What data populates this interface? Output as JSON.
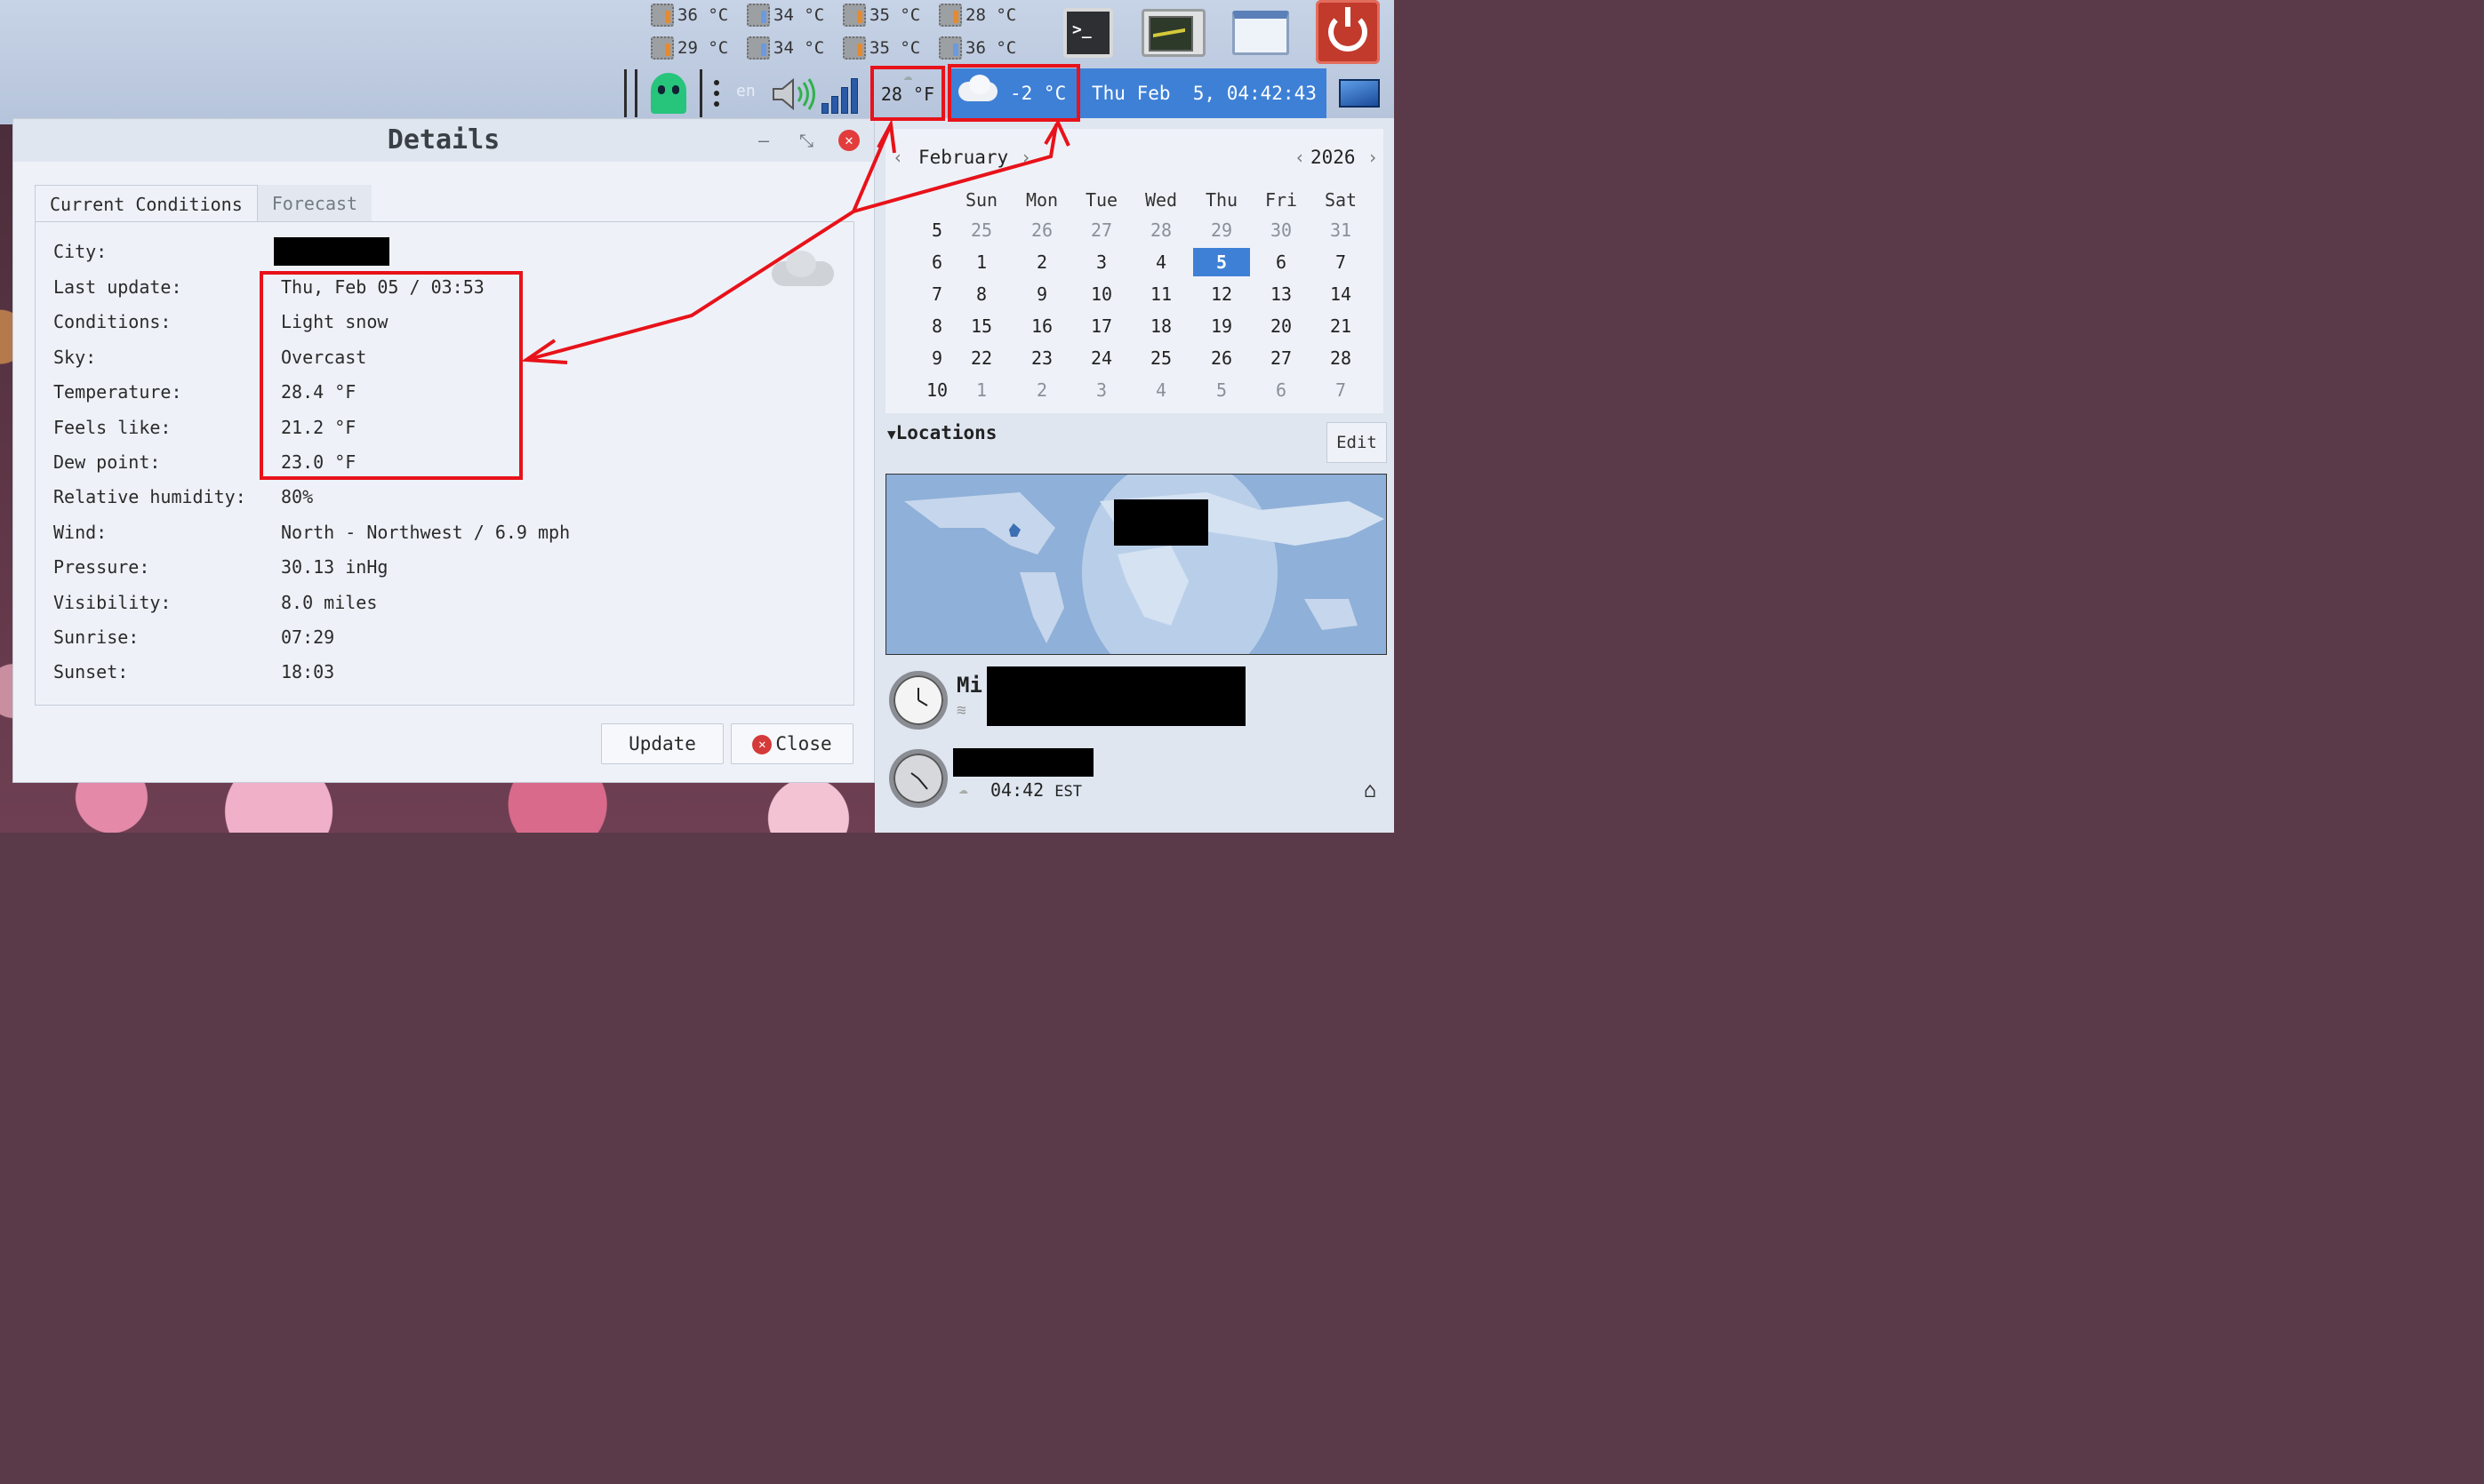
{
  "panel": {
    "sensors_row1": [
      "36 °C",
      "34 °C",
      "35 °C",
      "28 °C"
    ],
    "sensors_row2": [
      "29 °C",
      "34 °C",
      "35 °C",
      "36 °C"
    ],
    "language": "en",
    "tray_temperature": "28 °F",
    "weather_temperature": "-2 °C",
    "clock": "Thu Feb  5, 04:42:43"
  },
  "details_window": {
    "title": "Details",
    "tabs": [
      "Current Conditions",
      "Forecast"
    ],
    "fields": [
      {
        "label": "City:",
        "value": ""
      },
      {
        "label": "Last update:",
        "value": "Thu, Feb 05 / 03:53"
      },
      {
        "label": "Conditions:",
        "value": "Light snow"
      },
      {
        "label": "Sky:",
        "value": "Overcast"
      },
      {
        "label": "Temperature:",
        "value": "28.4 °F"
      },
      {
        "label": "Feels like:",
        "value": "21.2 °F"
      },
      {
        "label": "Dew point:",
        "value": "23.0 °F"
      },
      {
        "label": "Relative humidity:",
        "value": "80%"
      },
      {
        "label": "Wind:",
        "value": "North - Northwest / 6.9 mph"
      },
      {
        "label": "Pressure:",
        "value": "30.13 inHg"
      },
      {
        "label": "Visibility:",
        "value": "8.0 miles"
      },
      {
        "label": "Sunrise:",
        "value": "07:29"
      },
      {
        "label": "Sunset:",
        "value": "18:03"
      }
    ],
    "update_label": "Update",
    "close_label": "Close"
  },
  "calendar": {
    "month": "February",
    "year": "2026",
    "weekdays": [
      "Sun",
      "Mon",
      "Tue",
      "Wed",
      "Thu",
      "Fri",
      "Sat"
    ],
    "weeks": [
      {
        "week": "5",
        "days": [
          "25",
          "26",
          "27",
          "28",
          "29",
          "30",
          "31"
        ]
      },
      {
        "week": "6",
        "days": [
          "1",
          "2",
          "3",
          "4",
          "5",
          "6",
          "7"
        ]
      },
      {
        "week": "7",
        "days": [
          "8",
          "9",
          "10",
          "11",
          "12",
          "13",
          "14"
        ]
      },
      {
        "week": "8",
        "days": [
          "15",
          "16",
          "17",
          "18",
          "19",
          "20",
          "21"
        ]
      },
      {
        "week": "9",
        "days": [
          "22",
          "23",
          "24",
          "25",
          "26",
          "27",
          "28"
        ]
      },
      {
        "week": "10",
        "days": [
          "1",
          "2",
          "3",
          "4",
          "5",
          "6",
          "7"
        ]
      }
    ],
    "today": "5"
  },
  "locations": {
    "heading": "Locations",
    "edit_label": "Edit",
    "location1_name_partial": "Mi",
    "location2_time": "04:42",
    "location2_tz": "EST"
  },
  "colors": {
    "annotation": "#e8121a",
    "accent": "#3e80d6"
  }
}
